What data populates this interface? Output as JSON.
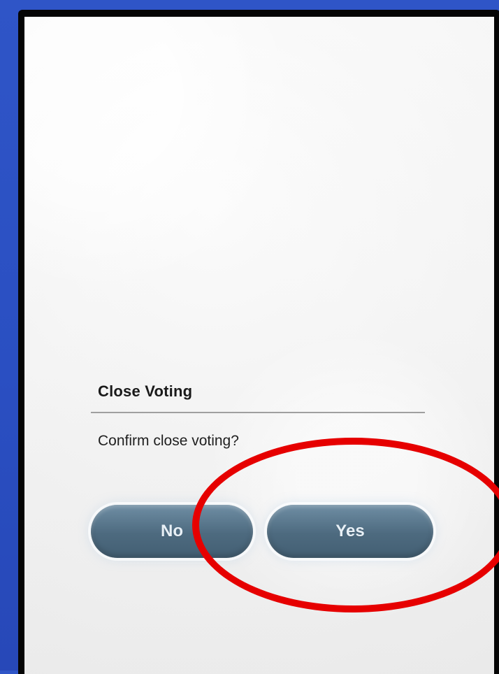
{
  "dialog": {
    "title": "Close Voting",
    "message": "Confirm close voting?",
    "buttons": {
      "no_label": "No",
      "yes_label": "Yes"
    }
  },
  "colors": {
    "background_blue": "#2f55c7",
    "frame_black": "#050505",
    "screen_bg": "#f2f2f2",
    "button_bg": "#4d6a7f",
    "button_text": "#e8f0f6",
    "highlight_red": "#e60000"
  },
  "annotations": {
    "highlighted_target": "yes-button"
  }
}
